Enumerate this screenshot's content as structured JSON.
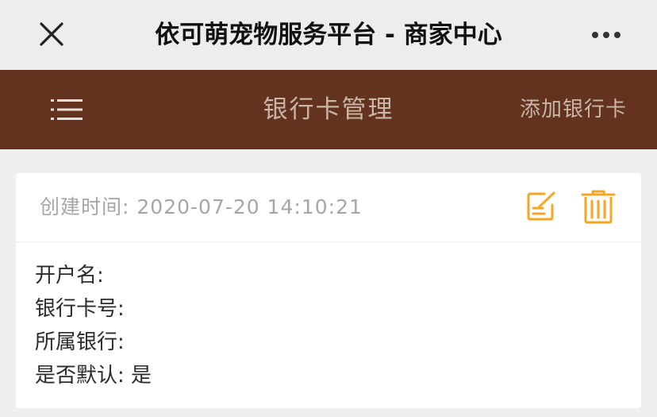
{
  "topbar": {
    "title": "依可萌宠物服务平台 - 商家中心",
    "close_icon": "close-icon",
    "more_icon": "more-dots-icon"
  },
  "header": {
    "title": "银行卡管理",
    "add_label": "添加银行卡",
    "menu_icon": "menu-icon",
    "background": "#643320",
    "text_color": "#c9b6a9"
  },
  "card": {
    "created_label": "创建时间:",
    "created_value": "2020-07-20 14:10:21",
    "edit_icon": "edit-icon",
    "delete_icon": "trash-icon",
    "accent": "#f5a623",
    "fields": [
      {
        "label": "开户名:",
        "value": ""
      },
      {
        "label": "银行卡号:",
        "value": ""
      },
      {
        "label": "所属银行:",
        "value": ""
      },
      {
        "label": "是否默认:",
        "value": "是"
      }
    ]
  }
}
